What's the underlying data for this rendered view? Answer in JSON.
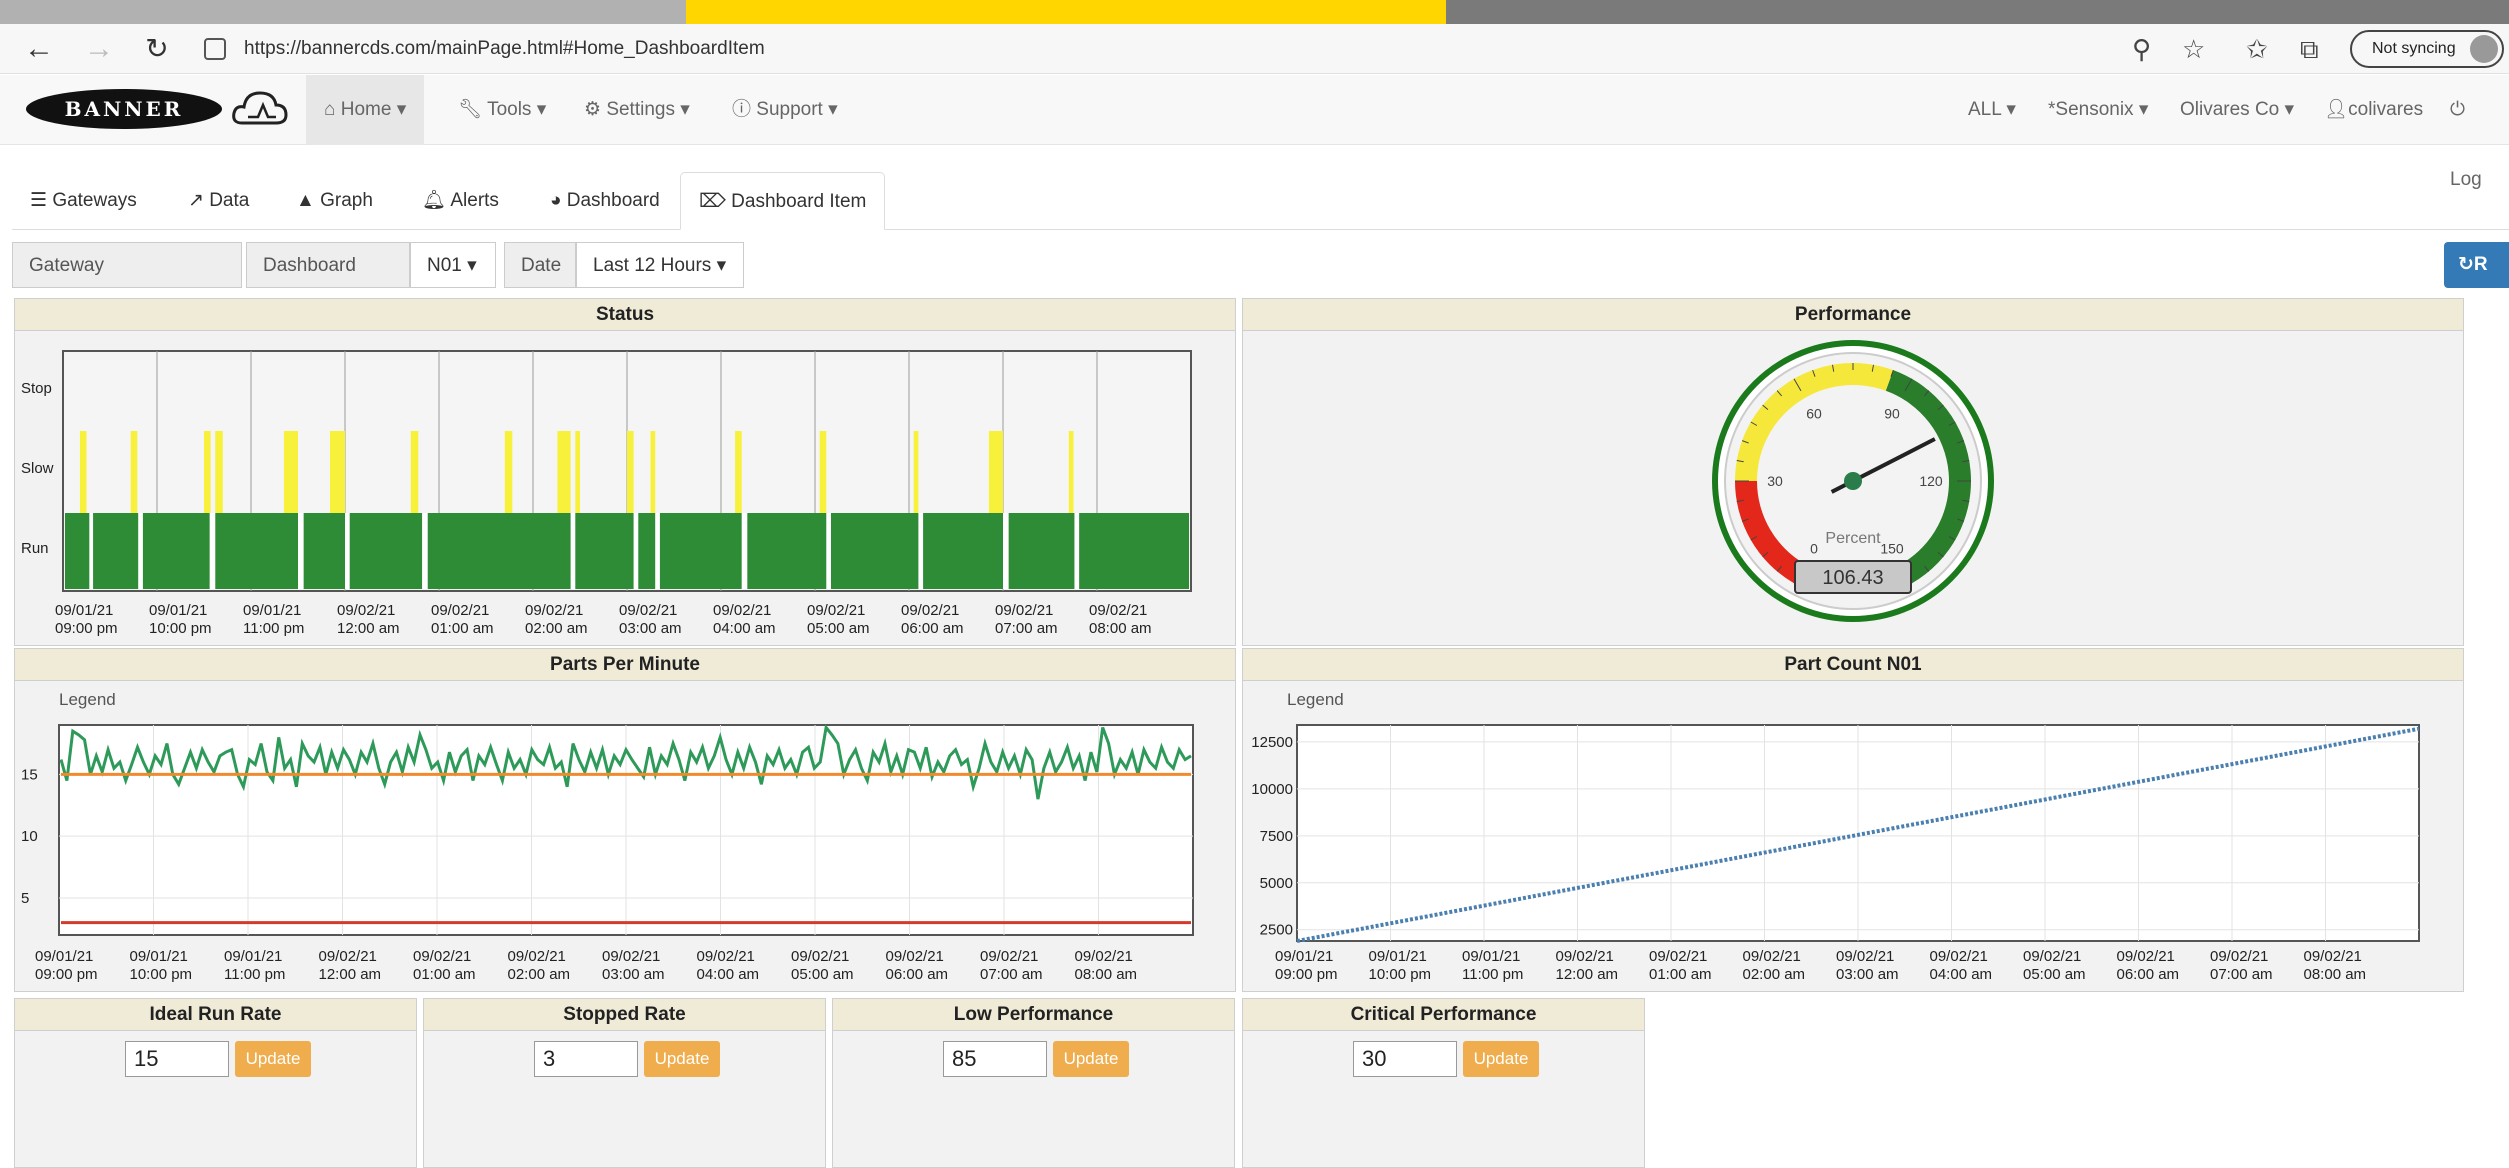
{
  "colors": {
    "stripe_gray": "#b1b1b1",
    "stripe_yellow": "#ffd600",
    "stripe_dark": "#7a7a7a",
    "run_green": "#2e8b36",
    "slow_yellow": "#f7f13c",
    "series_green": "#2e9a5a",
    "target_orange": "#f08a2c",
    "stopped_red": "#d23b2b",
    "accent_blue": "#337ab7",
    "update_orange": "#f0ad4e"
  },
  "browser": {
    "back_icon": "arrow-left-icon",
    "forward_icon": "arrow-right-icon",
    "reload_icon": "reload-icon",
    "url": "https://bannercds.com/mainPage.html#Home_DashboardItem",
    "sync_label": "Not syncing"
  },
  "header": {
    "logo_text": "BANNER",
    "menu": [
      {
        "label": "Home",
        "icon": "home-icon"
      },
      {
        "label": "Tools",
        "icon": "wrench-icon"
      },
      {
        "label": "Settings",
        "icon": "gears-icon"
      },
      {
        "label": "Support",
        "icon": "info-icon"
      }
    ],
    "right_menu": [
      {
        "label": "ALL"
      },
      {
        "label": "*Sensonix"
      },
      {
        "label": "Olivares Co"
      },
      {
        "label": "colivares",
        "icon": "user-icon"
      },
      {
        "label": "Log",
        "icon": "power-icon"
      }
    ]
  },
  "tabs": [
    {
      "label": "Gateways",
      "icon": "list-icon"
    },
    {
      "label": "Data",
      "icon": "line-chart-icon"
    },
    {
      "label": "Graph",
      "icon": "area-chart-icon"
    },
    {
      "label": "Alerts",
      "icon": "bell-icon"
    },
    {
      "label": "Dashboard",
      "icon": "dashboard-icon"
    },
    {
      "label": "Dashboard Item",
      "icon": "thermometer-icon"
    }
  ],
  "filters": {
    "gateway_label": "Gateway",
    "dashboard_item_label": "Dashboard Item",
    "dashboard_item_value": "N01",
    "date_label": "Date",
    "date_value": "Last 12 Hours",
    "refresh_label": "R"
  },
  "x_ticks": [
    [
      "09/01/21",
      "09:00 pm"
    ],
    [
      "09/01/21",
      "10:00 pm"
    ],
    [
      "09/01/21",
      "11:00 pm"
    ],
    [
      "09/02/21",
      "12:00 am"
    ],
    [
      "09/02/21",
      "01:00 am"
    ],
    [
      "09/02/21",
      "02:00 am"
    ],
    [
      "09/02/21",
      "03:00 am"
    ],
    [
      "09/02/21",
      "04:00 am"
    ],
    [
      "09/02/21",
      "05:00 am"
    ],
    [
      "09/02/21",
      "06:00 am"
    ],
    [
      "09/02/21",
      "07:00 am"
    ],
    [
      "09/02/21",
      "08:00 am"
    ]
  ],
  "panels": {
    "status": {
      "title": "Status",
      "chart_data": {
        "type": "bar",
        "title": "Status",
        "y_categories": [
          "Stop",
          "Slow",
          "Run"
        ],
        "x_range_hours": [
          21,
          33
        ],
        "default_state": "Run",
        "slow_intervals": [
          [
            21.18,
            21.25
          ],
          [
            21.72,
            21.79
          ],
          [
            22.5,
            22.57
          ],
          [
            22.62,
            22.7
          ],
          [
            23.35,
            23.5
          ],
          [
            23.84,
            24.0
          ],
          [
            24.7,
            24.78
          ],
          [
            25.7,
            25.78
          ],
          [
            26.26,
            26.4
          ],
          [
            26.45,
            26.5
          ],
          [
            27.0,
            27.07
          ],
          [
            27.25,
            27.3
          ],
          [
            28.15,
            28.22
          ],
          [
            29.05,
            29.12
          ],
          [
            30.05,
            30.1
          ],
          [
            30.85,
            31.0
          ],
          [
            31.7,
            31.75
          ]
        ],
        "gap_intervals": [
          [
            21.28,
            21.32
          ],
          [
            21.8,
            21.85
          ],
          [
            22.56,
            22.62
          ],
          [
            23.5,
            23.56
          ],
          [
            24.0,
            24.05
          ],
          [
            24.82,
            24.88
          ],
          [
            26.4,
            26.45
          ],
          [
            27.07,
            27.12
          ],
          [
            27.3,
            27.35
          ],
          [
            28.22,
            28.28
          ],
          [
            29.12,
            29.17
          ],
          [
            30.1,
            30.15
          ],
          [
            31.0,
            31.06
          ],
          [
            31.76,
            31.81
          ]
        ]
      }
    },
    "performance": {
      "title": "Performance",
      "chart_data": {
        "type": "gauge",
        "min": 0,
        "max": 150,
        "value": 106.43,
        "value_label": "106.43",
        "unit_label": "Percent",
        "tick_labels": [
          "0",
          "30",
          "60",
          "90",
          "120",
          "150"
        ],
        "bands": [
          {
            "from": 0,
            "to": 30,
            "color": "#e3271b"
          },
          {
            "from": 30,
            "to": 85,
            "color": "#f5e83a"
          },
          {
            "from": 85,
            "to": 150,
            "color": "#2a7d2a"
          }
        ]
      }
    },
    "ppm": {
      "title": "Parts Per Minute",
      "legend_label": "Legend",
      "chart_data": {
        "type": "line",
        "title": "Parts Per Minute",
        "x_range_hours": [
          21,
          33
        ],
        "ylim": [
          2,
          19
        ],
        "y_ticks": [
          5,
          10,
          15
        ],
        "series": [
          {
            "role": "measured",
            "color": "#2e9a5a",
            "values": [
              16.2,
              14.5,
              18.5,
              18.2,
              17.8,
              15.0,
              16.5,
              15.2,
              17.0,
              15.5,
              16.0,
              14.5,
              15.8,
              17.2,
              16.0,
              15.0,
              16.5,
              15.8,
              17.5,
              15.0,
              14.2,
              15.5,
              16.8,
              15.5,
              17.0,
              16.0,
              15.2,
              16.5,
              16.8,
              17.0,
              15.0,
              14.0,
              16.2,
              15.8,
              17.5,
              15.2,
              14.5,
              18.0,
              15.5,
              16.2,
              14.0,
              17.5,
              16.5,
              16.0,
              17.2,
              15.0,
              16.8,
              15.5,
              17.0,
              16.2,
              15.0,
              16.8,
              16.0,
              17.5,
              15.5,
              14.2,
              16.0,
              16.8,
              15.2,
              17.2,
              16.0,
              18.2,
              17.0,
              15.5,
              16.0,
              14.5,
              16.8,
              15.2,
              16.5,
              17.0,
              14.5,
              16.5,
              15.8,
              17.2,
              15.8,
              14.5,
              16.8,
              15.5,
              16.2,
              15.0,
              17.0,
              16.2,
              15.8,
              17.2,
              15.5,
              16.0,
              14.0,
              17.5,
              16.2,
              15.2,
              16.8,
              15.5,
              17.0,
              15.0,
              16.5,
              15.8,
              17.0,
              16.2,
              15.5,
              14.8,
              17.2,
              15.0,
              16.5,
              15.8,
              17.5,
              16.2,
              14.5,
              16.8,
              16.0,
              17.2,
              15.5,
              16.5,
              18.0,
              16.2,
              15.0,
              16.8,
              15.5,
              17.2,
              16.0,
              14.2,
              16.5,
              15.8,
              17.0,
              15.5,
              16.2,
              15.0,
              16.8,
              17.2,
              15.5,
              16.0,
              18.8,
              18.2,
              17.5,
              15.0,
              16.2,
              17.0,
              15.5,
              14.5,
              16.8,
              16.0,
              17.5,
              15.2,
              16.5,
              15.0,
              17.0,
              16.8,
              15.5,
              17.2,
              14.8,
              16.0,
              15.2,
              16.5,
              17.0,
              15.8,
              16.2,
              14.0,
              15.5,
              17.5,
              16.0,
              15.2,
              16.8,
              15.5,
              16.5,
              15.0,
              17.0,
              16.2,
              13.0,
              15.5,
              16.8,
              15.2,
              16.0,
              17.2,
              15.5,
              16.5,
              14.5,
              16.8,
              15.2,
              18.8,
              17.5,
              15.0,
              16.2,
              15.5,
              16.8,
              15.0,
              17.0,
              16.0,
              15.5,
              17.2,
              16.0,
              15.5,
              17.0,
              16.2,
              16.5
            ]
          },
          {
            "role": "ideal",
            "color": "#f08a2c",
            "values": [
              15,
              15
            ]
          },
          {
            "role": "stopped",
            "color": "#d23b2b",
            "values": [
              3,
              3
            ]
          }
        ]
      }
    },
    "partcount": {
      "title": "Part Count N01",
      "legend_label": "Legend",
      "chart_data": {
        "type": "line",
        "title": "Part Count N01",
        "x_range_hours": [
          21,
          33
        ],
        "ylim": [
          1900,
          13400
        ],
        "y_ticks": [
          2500,
          5000,
          7500,
          10000,
          12500
        ],
        "series": [
          {
            "role": "count",
            "color": "#4a7fb0",
            "x": [
              21,
              33
            ],
            "values": [
              1900,
              13200
            ]
          }
        ]
      }
    }
  },
  "settings": [
    {
      "title": "Ideal Run Rate",
      "value": "15",
      "button": "Update"
    },
    {
      "title": "Stopped Rate",
      "value": "3",
      "button": "Update"
    },
    {
      "title": "Low Performance",
      "value": "85",
      "button": "Update"
    },
    {
      "title": "Critical Performance",
      "value": "30",
      "button": "Update"
    }
  ]
}
